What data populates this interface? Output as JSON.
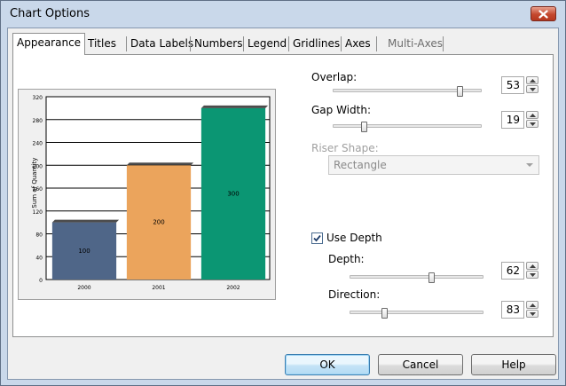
{
  "window": {
    "title": "Chart Options"
  },
  "tabs": [
    {
      "label": "Appearance",
      "active": true,
      "enabled": true
    },
    {
      "label": "Titles",
      "active": false,
      "enabled": true
    },
    {
      "label": "Data Labels",
      "active": false,
      "enabled": true
    },
    {
      "label": "Numbers",
      "active": false,
      "enabled": true
    },
    {
      "label": "Legend",
      "active": false,
      "enabled": true
    },
    {
      "label": "Gridlines",
      "active": false,
      "enabled": true
    },
    {
      "label": "Axes",
      "active": false,
      "enabled": true
    },
    {
      "label": "Multi-Axes",
      "active": false,
      "enabled": false
    }
  ],
  "controls": {
    "overlap": {
      "label": "Overlap:",
      "value": "53",
      "level": 0.87
    },
    "gap_width": {
      "label": "Gap Width:",
      "value": "19",
      "level": 0.2
    },
    "riser_shape": {
      "label": "Riser Shape:",
      "value": "Rectangle",
      "enabled": false
    },
    "use_depth": {
      "label": "Use Depth",
      "checked": true
    },
    "depth": {
      "label": "Depth:",
      "value": "62",
      "level": 0.62
    },
    "direction": {
      "label": "Direction:",
      "value": "83",
      "level": 0.25
    }
  },
  "buttons": {
    "ok": "OK",
    "cancel": "Cancel",
    "help": "Help"
  },
  "chart_data": {
    "type": "bar",
    "categories": [
      "2000",
      "2001",
      "2002"
    ],
    "values": [
      100,
      200,
      300
    ],
    "data_labels": [
      "100",
      "200",
      "300"
    ],
    "colors": [
      "#4f6688",
      "#eba45c",
      "#0b9673"
    ],
    "ylabel": "Sum of Quantity",
    "yticks": [
      "0",
      "40",
      "80",
      "120",
      "160",
      "200",
      "240",
      "280",
      "320"
    ],
    "ylim": [
      0,
      320
    ],
    "grid": true
  }
}
